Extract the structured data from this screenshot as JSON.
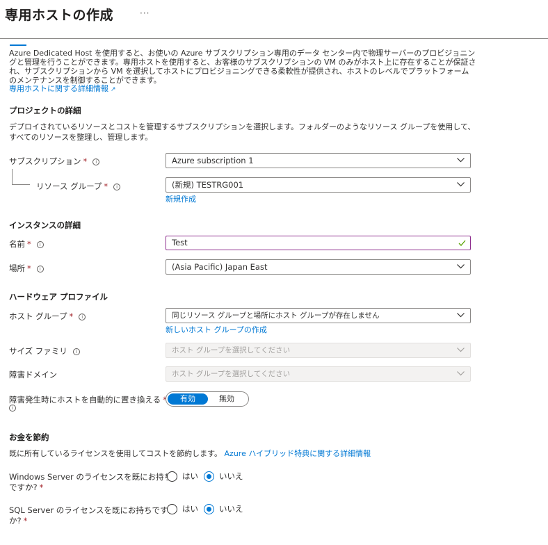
{
  "header": {
    "title": "専用ホストの作成",
    "more_label": "···"
  },
  "intro": {
    "text": "Azure Dedicated Host を使用すると、お使いの Azure サブスクリプション専用のデータ センター内で物理サーバーのプロビジョニングと管理を行うことができます。専用ホストを使用すると、お客様のサブスクリプションの VM のみがホスト上に存在することが保証され、サブスクリプションから VM を選択してホストにプロビジョニングできる柔軟性が提供され、ホストのレベルでプラットフォームのメンテナンスを制御することができます。",
    "learn_more": "専用ホストに関する詳細情報"
  },
  "project": {
    "title": "プロジェクトの詳細",
    "description": "デプロイされているリソースとコストを管理するサブスクリプションを選択します。フォルダーのようなリソース グループを使用して、すべてのリソースを整理し、管理します。",
    "subscription_label": "サブスクリプション",
    "subscription_value": "Azure subscription 1",
    "resource_group_label": "リソース グループ",
    "resource_group_value": "(新規) TESTRG001",
    "create_new": "新規作成"
  },
  "instance": {
    "title": "インスタンスの詳細",
    "name_label": "名前",
    "name_value": "Test",
    "location_label": "場所",
    "location_value": "(Asia Pacific) Japan East"
  },
  "hardware": {
    "title": "ハードウェア プロファイル",
    "host_group_label": "ホスト グループ",
    "host_group_value": "同じリソース グループと場所にホスト グループが存在しません",
    "create_host_group": "新しいホスト グループの作成",
    "size_family_label": "サイズ ファミリ",
    "size_family_placeholder": "ホスト グループを選択してください",
    "fault_domain_label": "障害ドメイン",
    "fault_domain_placeholder": "ホスト グループを選択してください",
    "auto_replace_label": "障害発生時にホストを自動的に置き換える",
    "toggle_on": "有効",
    "toggle_off": "無効",
    "toggle_selected": "有効"
  },
  "savings": {
    "title": "お金を節約",
    "description": "既に所有しているライセンスを使用してコストを節約します。",
    "hybrid_link": "Azure ハイブリッド特典に関する詳細情報",
    "windows_label_line1": "Windows Server のライセンスを既にお持ち",
    "windows_label_line2": "ですか?",
    "sql_label_line1": "SQL Server のライセンスを既にお持ちです",
    "sql_label_line2": "か?",
    "yes": "はい",
    "no": "いいえ",
    "windows_selected": "いいえ",
    "sql_selected": "いいえ"
  },
  "required_mark": "*",
  "info_glyph": "i",
  "colors": {
    "accent": "#0078d4",
    "required": "#a4262c",
    "valid": "#57a300",
    "text": "#323130"
  }
}
